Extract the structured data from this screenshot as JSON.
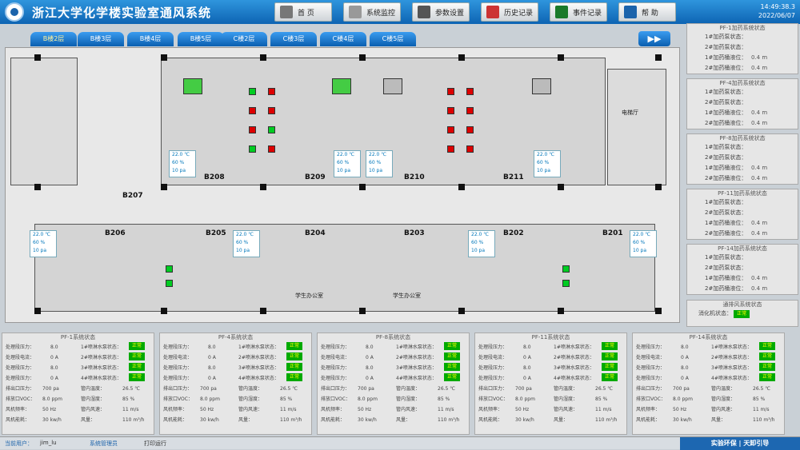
{
  "header": {
    "title": "浙江大学化学楼实验室通风系统",
    "time": "14:49:38.3",
    "date": "2022/06/07"
  },
  "nav": [
    {
      "label": "首 页",
      "icon": "home-icon"
    },
    {
      "label": "系统监控",
      "icon": "monitor-icon"
    },
    {
      "label": "参数设置",
      "icon": "wrench-icon"
    },
    {
      "label": "历史记录",
      "icon": "history-icon"
    },
    {
      "label": "事件记录",
      "icon": "excel-icon"
    },
    {
      "label": "帮 助",
      "icon": "help-icon"
    }
  ],
  "tabs": [
    "B楼2层",
    "B楼3层",
    "B楼4层",
    "B楼5层",
    "C楼2层",
    "C楼3层",
    "C楼4层",
    "C楼5层"
  ],
  "rooms": {
    "b208": "B208",
    "b209": "B209",
    "b210": "B210",
    "b211": "B211",
    "b207": "B207",
    "b206": "B206",
    "b205": "B205",
    "b204": "B204",
    "b203": "B203",
    "b202": "B202",
    "b201": "B201",
    "office1": "学生办公室",
    "office2": "学生办公室",
    "elevator": "电梯厅"
  },
  "sensors": [
    {
      "t": "22.0 ℃",
      "h": "60 %",
      "p": "10 pa"
    },
    {
      "t": "22.0 ℃",
      "h": "60 %",
      "p": "10 pa"
    },
    {
      "t": "22.0 ℃",
      "h": "60 %",
      "p": "10 pa"
    },
    {
      "t": "22.0 ℃",
      "h": "60 %",
      "p": "10 pa"
    },
    {
      "t": "22.0 ℃",
      "h": "60 %",
      "p": "10 pa"
    },
    {
      "t": "22.0 ℃",
      "h": "60 %",
      "p": "10 pa"
    },
    {
      "t": "22.0 ℃",
      "h": "60 %",
      "p": "10 pa"
    },
    {
      "t": "22.0 ℃",
      "h": "60 %",
      "p": "10 pa"
    }
  ],
  "right_panels": [
    {
      "title": "PF-1加药系统状态",
      "rows": [
        {
          "label": "1#加药泵状态：",
          "value": ""
        },
        {
          "label": "2#加药泵状态：",
          "value": ""
        },
        {
          "label": "1#加药桶液位：",
          "value": "0.4 m"
        },
        {
          "label": "2#加药桶液位：",
          "value": "0.4 m"
        }
      ]
    },
    {
      "title": "PF-4加药系统状态",
      "rows": [
        {
          "label": "1#加药泵状态：",
          "value": ""
        },
        {
          "label": "2#加药泵状态：",
          "value": ""
        },
        {
          "label": "1#加药桶液位：",
          "value": "0.4 m"
        },
        {
          "label": "2#加药桶液位：",
          "value": "0.4 m"
        }
      ]
    },
    {
      "title": "PF-8加药系统状态",
      "rows": [
        {
          "label": "1#加药泵状态：",
          "value": ""
        },
        {
          "label": "2#加药泵状态：",
          "value": ""
        },
        {
          "label": "1#加药桶液位：",
          "value": "0.4 m"
        },
        {
          "label": "2#加药桶液位：",
          "value": "0.4 m"
        }
      ]
    },
    {
      "title": "PF-11加药系统状态",
      "rows": [
        {
          "label": "1#加药泵状态：",
          "value": ""
        },
        {
          "label": "2#加药泵状态：",
          "value": ""
        },
        {
          "label": "1#加药桶液位：",
          "value": "0.4 m"
        },
        {
          "label": "2#加药桶液位：",
          "value": "0.4 m"
        }
      ]
    },
    {
      "title": "PF-14加药系统状态",
      "rows": [
        {
          "label": "1#加药泵状态：",
          "value": ""
        },
        {
          "label": "2#加药泵状态：",
          "value": ""
        },
        {
          "label": "1#加药桶液位：",
          "value": "0.4 m"
        },
        {
          "label": "2#加药桶液位：",
          "value": "0.4 m"
        }
      ]
    }
  ],
  "purifier": {
    "title": "通排风系统状态",
    "label": "消化机状态：",
    "value": "正常"
  },
  "status_panels": [
    {
      "title": "PF-1系统状态",
      "l": [
        [
          "处理段压力：",
          "8.0"
        ],
        [
          "处理段电流：",
          "0 A"
        ],
        [
          "处理段压力：",
          "8.0"
        ],
        [
          "处理段压力：",
          "0 A"
        ]
      ],
      "m": [
        [
          "1#喷淋水泵状态：",
          "正常"
        ],
        [
          "2#喷淋水泵状态：",
          "正常"
        ],
        [
          "3#喷淋水泵状态：",
          "正常"
        ],
        [
          "4#喷淋水泵状态：",
          "正常"
        ]
      ],
      "b": [
        [
          "排出口压力：",
          "700 pa",
          "管内温度：",
          "26.5 ℃"
        ],
        [
          "排放口VOC：",
          "8.0 ppm",
          "管内湿度：",
          "85 %"
        ],
        [
          "风机频率：",
          "50 Hz",
          "管内风速：",
          "11 m/s"
        ],
        [
          "风机能耗：",
          "30 kw/h",
          "风量：",
          "110 m³/h"
        ]
      ]
    },
    {
      "title": "PF-4系统状态",
      "l": [
        [
          "处理段压力：",
          "8.0"
        ],
        [
          "处理段电流：",
          "0 A"
        ],
        [
          "处理段压力：",
          "8.0"
        ],
        [
          "处理段压力：",
          "0 A"
        ]
      ],
      "m": [
        [
          "1#喷淋水泵状态：",
          "正常"
        ],
        [
          "2#喷淋水泵状态：",
          "正常"
        ],
        [
          "3#喷淋水泵状态：",
          "正常"
        ],
        [
          "4#喷淋水泵状态：",
          "正常"
        ]
      ],
      "b": [
        [
          "排出口压力：",
          "700 pa",
          "管内温度：",
          "26.5 ℃"
        ],
        [
          "排放口VOC：",
          "8.0 ppm",
          "管内湿度：",
          "85 %"
        ],
        [
          "风机频率：",
          "50 Hz",
          "管内风速：",
          "11 m/s"
        ],
        [
          "风机能耗：",
          "30 kw/h",
          "风量：",
          "110 m³/h"
        ]
      ]
    },
    {
      "title": "PF-8系统状态",
      "l": [
        [
          "处理段压力：",
          "8.0"
        ],
        [
          "处理段电流：",
          "0 A"
        ],
        [
          "处理段压力：",
          "8.0"
        ],
        [
          "处理段压力：",
          "0 A"
        ]
      ],
      "m": [
        [
          "1#喷淋水泵状态：",
          "正常"
        ],
        [
          "2#喷淋水泵状态：",
          "正常"
        ],
        [
          "3#喷淋水泵状态：",
          "正常"
        ],
        [
          "4#喷淋水泵状态：",
          "正常"
        ]
      ],
      "b": [
        [
          "排出口压力：",
          "700 pa",
          "管内温度：",
          "26.5 ℃"
        ],
        [
          "排放口VOC：",
          "8.0 ppm",
          "管内湿度：",
          "85 %"
        ],
        [
          "风机频率：",
          "50 Hz",
          "管内风速：",
          "11 m/s"
        ],
        [
          "风机能耗：",
          "30 kw/h",
          "风量：",
          "110 m³/h"
        ]
      ]
    },
    {
      "title": "PF-11系统状态",
      "l": [
        [
          "处理段压力：",
          "8.0"
        ],
        [
          "处理段电流：",
          "0 A"
        ],
        [
          "处理段压力：",
          "8.0"
        ],
        [
          "处理段压力：",
          "0 A"
        ]
      ],
      "m": [
        [
          "1#喷淋水泵状态：",
          "正常"
        ],
        [
          "2#喷淋水泵状态：",
          "正常"
        ],
        [
          "3#喷淋水泵状态：",
          "正常"
        ],
        [
          "4#喷淋水泵状态：",
          "正常"
        ]
      ],
      "b": [
        [
          "排出口压力：",
          "700 pa",
          "管内温度：",
          "26.5 ℃"
        ],
        [
          "排放口VOC：",
          "8.0 ppm",
          "管内湿度：",
          "85 %"
        ],
        [
          "风机频率：",
          "50 Hz",
          "管内风速：",
          "11 m/s"
        ],
        [
          "风机能耗：",
          "30 kw/h",
          "风量：",
          "110 m³/h"
        ]
      ]
    },
    {
      "title": "PF-14系统状态",
      "l": [
        [
          "处理段压力：",
          "8.0"
        ],
        [
          "处理段电流：",
          "0 A"
        ],
        [
          "处理段压力：",
          "8.0"
        ],
        [
          "处理段压力：",
          "0 A"
        ]
      ],
      "m": [
        [
          "1#喷淋水泵状态：",
          "正常"
        ],
        [
          "2#喷淋水泵状态：",
          "正常"
        ],
        [
          "3#喷淋水泵状态：",
          "正常"
        ],
        [
          "4#喷淋水泵状态：",
          "正常"
        ]
      ],
      "b": [
        [
          "排出口压力：",
          "700 pa",
          "管内温度：",
          "26.5 ℃"
        ],
        [
          "排放口VOC：",
          "8.0 ppm",
          "管内湿度：",
          "85 %"
        ],
        [
          "风机频率：",
          "50 Hz",
          "管内风速：",
          "11 m/s"
        ],
        [
          "风机能耗：",
          "30 kw/h",
          "风量：",
          "110 m³/h"
        ]
      ]
    }
  ],
  "status": {
    "user_label": "当前用户：",
    "user": "jim_lu",
    "role": "系统管理员",
    "action": "打印运行",
    "brand": "实验环保 | 天卸引导"
  },
  "colors": {
    "header": "#0d64b3",
    "ok": "#00aa00",
    "alarm": "#dd0000"
  }
}
